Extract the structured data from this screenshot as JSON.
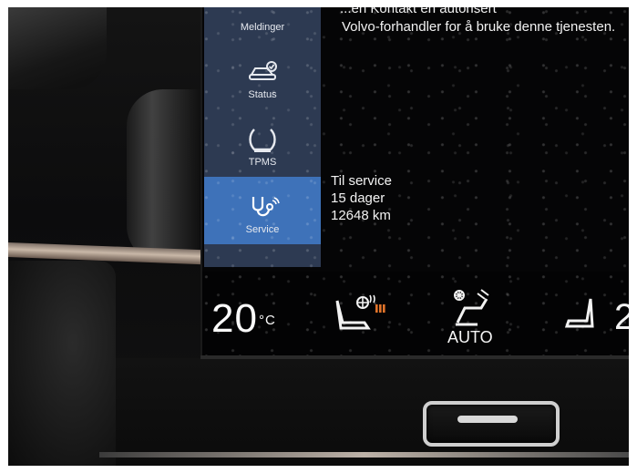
{
  "screen": {
    "header_line1": "...en Kontakt en autorisert",
    "header_line2": "Volvo-forhandler for å bruke denne tjenesten."
  },
  "sidebar": {
    "items": [
      {
        "label": "Meldinger",
        "icon": "messages-icon"
      },
      {
        "label": "Status",
        "icon": "car-status-icon"
      },
      {
        "label": "TPMS",
        "icon": "tire-pressure-icon"
      },
      {
        "label": "Service",
        "icon": "service-stethoscope-icon",
        "active": true
      }
    ]
  },
  "service": {
    "heading": "Til service",
    "days": "15 dager",
    "distance": "12648 km"
  },
  "climate": {
    "temperature": "20",
    "unit": "°C",
    "fan_mode": "AUTO",
    "seat_heat_level": 3
  },
  "colors": {
    "sidebar_bg": "#2d3a52",
    "active_item": "#3e72b9",
    "heat_indicator": "#e0732a"
  }
}
